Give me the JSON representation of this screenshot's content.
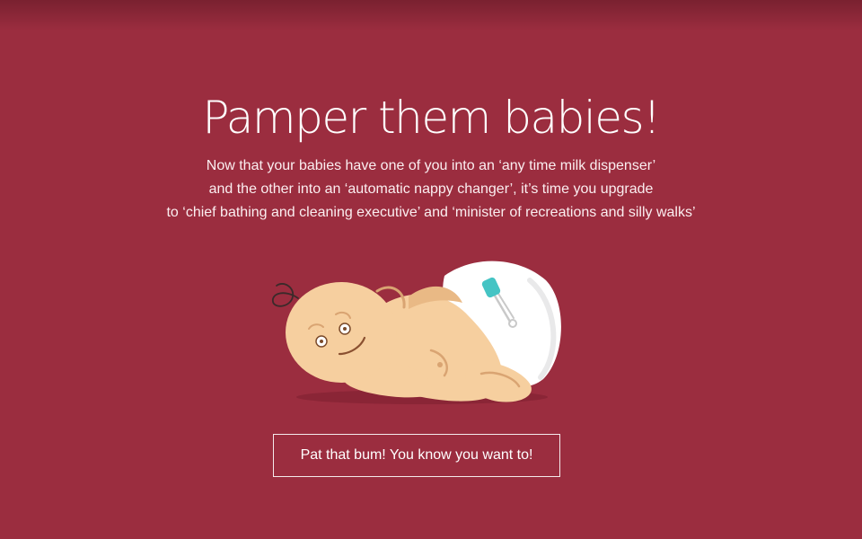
{
  "hero": {
    "title": "Pamper them babies!",
    "description_lines": [
      "Now that your babies have one of you into an ‘any time milk dispenser’",
      "and the other into an ‘automatic nappy changer’, it’s time you upgrade",
      "to ‘chief bathing and cleaning executive’ and ‘minister of recreations and silly walks’"
    ],
    "button_label": "Pat that bum! You know you want to!"
  },
  "colors": {
    "background": "#9b2d3f",
    "text": "#ffffff",
    "baby_skin": "#f6cf9f",
    "diaper": "#ffffff",
    "safety_pin_clasp": "#45c4c4"
  },
  "icons": {
    "illustration": "sleeping-baby-in-diaper"
  }
}
